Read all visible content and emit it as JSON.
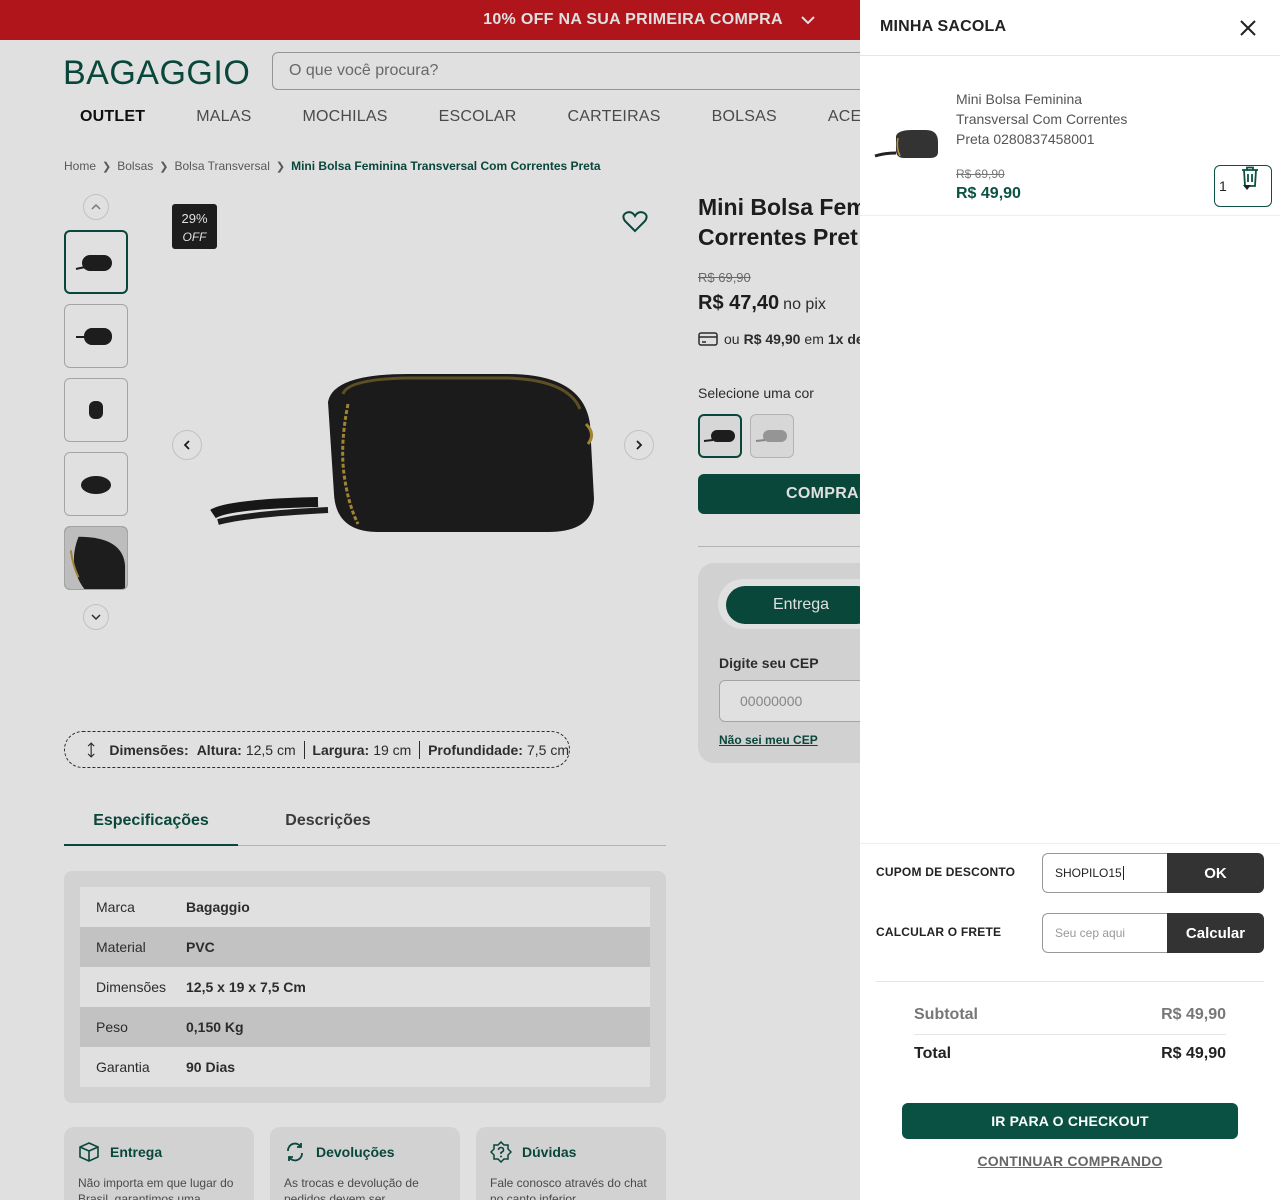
{
  "promo": {
    "text": "10% OFF NA SUA PRIMEIRA COMPRA"
  },
  "header": {
    "logo": "BAGAGGIO",
    "search_placeholder": "O que você procura?"
  },
  "nav": {
    "items": [
      {
        "label": "OUTLET"
      },
      {
        "label": "MALAS"
      },
      {
        "label": "MOCHILAS"
      },
      {
        "label": "ESCOLAR"
      },
      {
        "label": "CARTEIRAS"
      },
      {
        "label": "BOLSAS"
      },
      {
        "label": "ACESSÓRI"
      }
    ]
  },
  "breadcrumb": {
    "items": [
      "Home",
      "Bolsas",
      "Bolsa Transversal"
    ],
    "current": "Mini Bolsa Feminina Transversal Com Correntes Preta"
  },
  "gallery": {
    "discount_percent": "29%",
    "discount_label": "OFF"
  },
  "product": {
    "title_line1": "Mini Bolsa Fem",
    "title_line2": "Correntes Pret",
    "old_price": "R$ 69,90",
    "pix_price": "R$ 47,40",
    "pix_label": "no pix",
    "card_prefix": "ou",
    "card_price": "R$ 49,90",
    "card_mid": "em",
    "card_installments": "1x de",
    "color_label": "Selecione uma cor",
    "buy_label": "COMPRAR"
  },
  "delivery": {
    "tab_label": "Entrega",
    "cep_label": "Digite seu CEP",
    "cep_placeholder": "00000000",
    "cep_link": "Não sei meu CEP"
  },
  "dimensions": {
    "label": "Dimensões:",
    "height_label": "Altura:",
    "height": "12,5 cm",
    "width_label": "Largura:",
    "width": "19 cm",
    "depth_label": "Profundidade:",
    "depth": "7,5 cm"
  },
  "tabs": {
    "specs": "Especificações",
    "descriptions": "Descrições"
  },
  "specs": [
    {
      "key": "Marca",
      "value": "Bagaggio"
    },
    {
      "key": "Material",
      "value": "PVC"
    },
    {
      "key": "Dimensões",
      "value": "12,5 x 19 x 7,5 Cm"
    },
    {
      "key": "Peso",
      "value": "0,150 Kg"
    },
    {
      "key": "Garantia",
      "value": "90 Dias"
    }
  ],
  "info_cards": [
    {
      "title": "Entrega",
      "text": "Não importa em que lugar do Brasil, garantimos uma"
    },
    {
      "title": "Devoluções",
      "text": "As trocas e devolução de pedidos devem ser"
    },
    {
      "title": "Dúvidas",
      "text": "Fale conosco através do chat no canto inferior"
    }
  ],
  "cart": {
    "title": "MINHA SACOLA",
    "item": {
      "name": "Mini Bolsa Feminina Transversal Com Correntes Preta 0280837458001",
      "old_price": "R$ 69,90",
      "price": "R$ 49,90",
      "quantity": "1"
    },
    "coupon_label": "CUPOM DE DESCONTO",
    "coupon_value": "SHOPILO15",
    "coupon_button": "OK",
    "shipping_label": "CALCULAR O FRETE",
    "shipping_placeholder": "Seu cep aqui",
    "shipping_button": "Calcular",
    "subtotal_label": "Subtotal",
    "subtotal_value": "R$ 49,90",
    "total_label": "Total",
    "total_value": "R$ 49,90",
    "checkout_label": "IR PARA O CHECKOUT",
    "continue_label": "CONTINUAR COMPRANDO"
  },
  "colors": {
    "brand_green": "#0b5143",
    "promo_red": "#c8181e"
  }
}
